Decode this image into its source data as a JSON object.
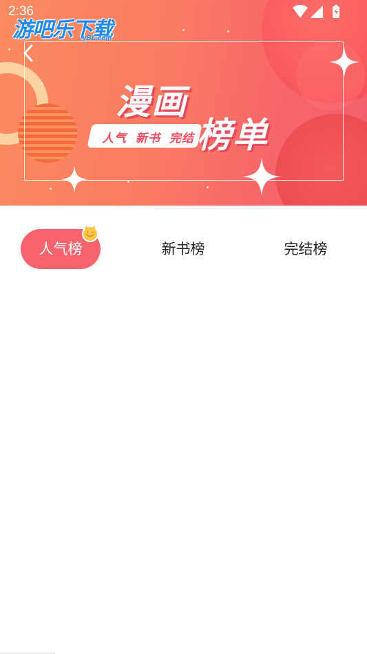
{
  "status_bar": {
    "time": "2:36",
    "icons": [
      "wifi-icon",
      "signal-icon",
      "battery-charging-icon"
    ]
  },
  "watermark": {
    "text": "游吧乐下载",
    "url": "yBL.com"
  },
  "banner": {
    "title_line1": "漫画",
    "title_line2": "榜单",
    "tagline": "人气 新书 完结",
    "colors": {
      "gradient_start": "#fb8c5f",
      "gradient_end": "#f0606c",
      "title_shadow": "#e5485a"
    }
  },
  "tabs": [
    {
      "label": "人气榜",
      "active": true
    },
    {
      "label": "新书榜",
      "active": false
    },
    {
      "label": "完结榜",
      "active": false
    }
  ],
  "accent_color": "#f7646d"
}
